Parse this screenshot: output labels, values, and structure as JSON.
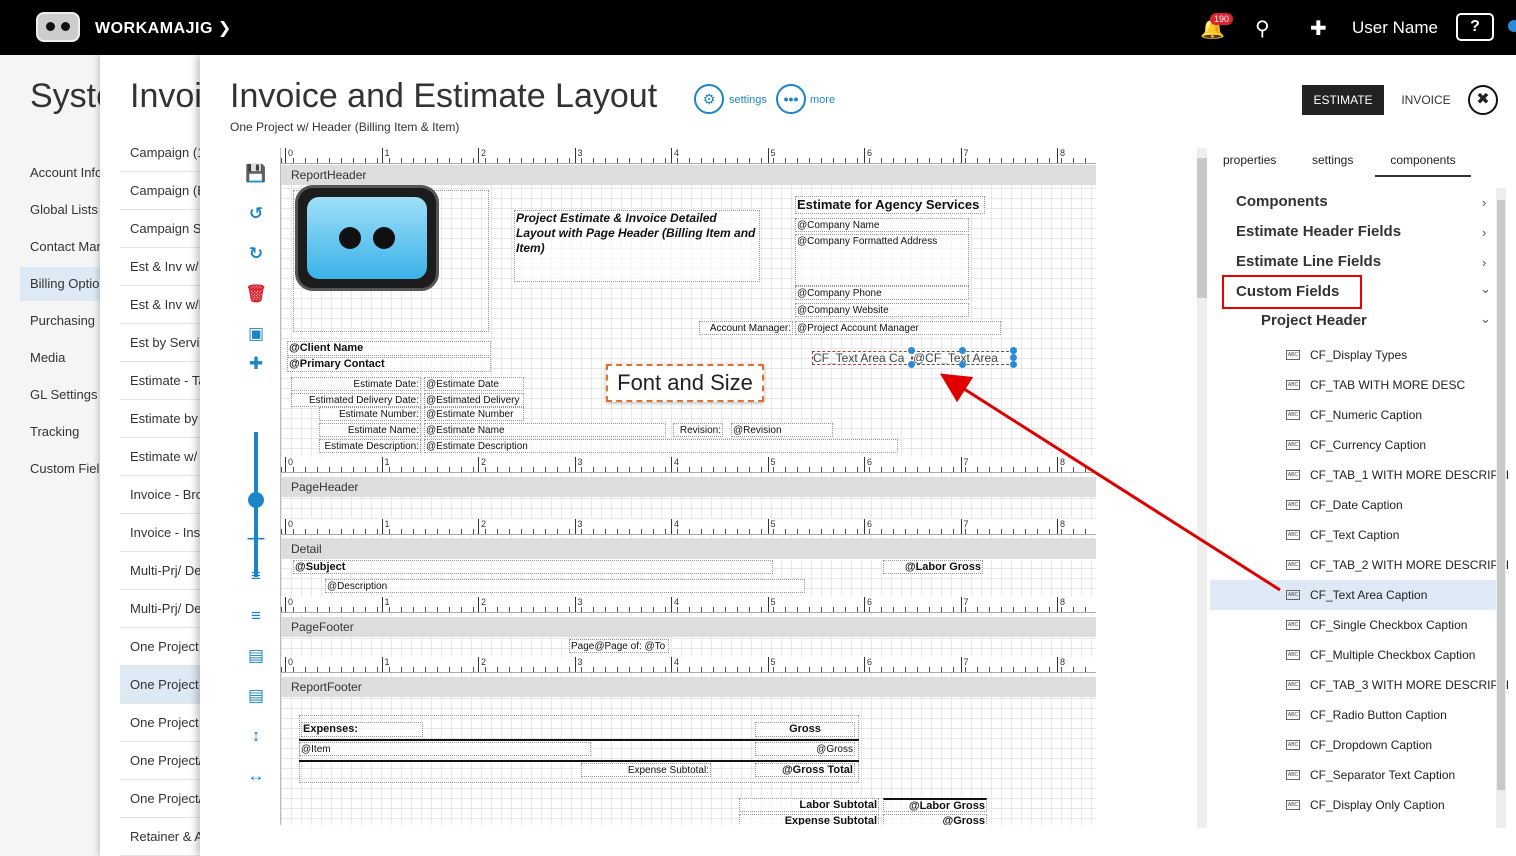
{
  "topbar": {
    "app_name": "WORKAMAJIG",
    "notification_count": "190",
    "user_name": "User Name",
    "help_label": "?"
  },
  "panel1": {
    "title": "Syste",
    "items": [
      "Account Info",
      "Global Lists",
      "Contact Man",
      "Billing Optio",
      "Purchasing",
      "Media",
      "GL Settings",
      "Tracking",
      "Custom Field"
    ],
    "active_index": 3
  },
  "panel2": {
    "title": "Invoi",
    "items": [
      "Campaign (1",
      "Campaign (B",
      "Campaign Su",
      "Est & Inv w/ S",
      "Est & Inv w/H",
      "Est by Servic",
      "Estimate - Ta",
      "Estimate by S",
      "Estimate w/ (",
      "Invoice - Bro",
      "Invoice - Inse",
      "Multi-Prj/ De",
      "Multi-Prj/ De",
      "One Project S",
      "One Project v",
      "One Project v",
      "One Project/",
      "One Project/",
      "Retainer & A"
    ],
    "active_index": 14
  },
  "main": {
    "title": "Invoice and Estimate Layout",
    "subtitle": "One Project w/ Header (Billing Item & Item)",
    "settings_label": "settings",
    "more_label": "more",
    "estimate_label": "ESTIMATE",
    "invoice_label": "INVOICE"
  },
  "ruler_numbers": [
    "0",
    "1",
    "2",
    "3",
    "4",
    "5",
    "6",
    "7",
    "8"
  ],
  "bands": {
    "report_header": "ReportHeader",
    "page_header": "PageHeader",
    "detail": "Detail",
    "page_footer": "PageFooter",
    "report_footer": "ReportFooter"
  },
  "report_header": {
    "layout_title": "Project Estimate & Invoice Detailed Layout with Page Header (Billing Item and Item)",
    "agency_title": "Estimate for Agency Services",
    "company_name": "@Company Name",
    "company_address": "@Company Formatted Address",
    "company_phone": "@Company Phone",
    "company_website": "@Company Website",
    "account_manager_label": "Account Manager:",
    "account_manager_value": "@Project Account Manager",
    "client_name": "@Client Name",
    "primary_contact": "@Primary Contact",
    "font_and_size": "Font and Size",
    "cf_text_area_1": "CF_Text Area Ca",
    "cf_text_area_2": "@CF_Text Area",
    "fields": [
      {
        "label": "Estimate Date:",
        "value": "@Estimate Date"
      },
      {
        "label": "Estimated Delivery Date:",
        "value": "@Estimated Delivery"
      },
      {
        "label": "Estimate Number:",
        "value": "@Estimate Number"
      },
      {
        "label": "Estimate Name:",
        "value": "@Estimate Name"
      },
      {
        "label": "Estimate Description:",
        "value": "@Estimate Description"
      }
    ],
    "revision_label": "Revision:",
    "revision_value": "@Revision"
  },
  "detail": {
    "subject": "@Subject",
    "labor_gross": "@Labor Gross",
    "description": "@Description"
  },
  "page_footer": {
    "page_text": "Page@Page of: @To"
  },
  "report_footer": {
    "expenses_label": "Expenses:",
    "gross_label": "Gross",
    "item": "@Item",
    "gross_value": "@Gross",
    "expense_subtotal_label": "Expense Subtotal:",
    "gross_total": "@Gross Total",
    "labor_subtotal_label": "Labor Subtotal",
    "labor_gross": "@Labor Gross",
    "expense_subtotal_2": "Expense Subtotal",
    "gross_2": "@Gross"
  },
  "right_panel": {
    "tabs": [
      "properties",
      "settings",
      "components"
    ],
    "active_tab": 2,
    "sections": [
      "Components",
      "Estimate Header Fields",
      "Estimate Line Fields",
      "Custom Fields"
    ],
    "subsection": "Project Header",
    "icon_text": "ABC",
    "custom_fields": [
      "CF_Display Types",
      "CF_TAB WITH MORE DESC",
      "CF_Numeric Caption",
      "CF_Currency Caption",
      "CF_TAB_1 WITH MORE DESCRIPTI",
      "CF_Date Caption",
      "CF_Text Caption",
      "CF_TAB_2 WITH MORE DESCRIPTI",
      "CF_Text Area Caption",
      "CF_Single Checkbox Caption",
      "CF_Multiple Checkbox Caption",
      "CF_TAB_3 WITH MORE DESCRIPTI",
      "CF_Radio Button Caption",
      "CF_Dropdown Caption",
      "CF_Separator Text Caption",
      "CF_Display Only Caption"
    ],
    "selected_field_index": 8
  },
  "colors": {
    "accent": "#1a86c8",
    "annotation": "#e00000",
    "selection": "#ddeaf5"
  }
}
